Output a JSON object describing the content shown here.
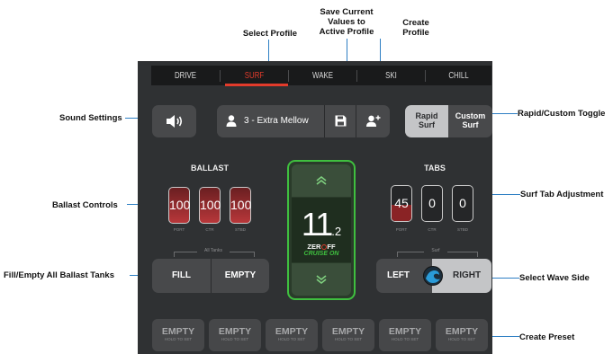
{
  "tabs": [
    "DRIVE",
    "SURF",
    "WAKE",
    "SKI",
    "CHILL"
  ],
  "active_tab": "SURF",
  "profile": {
    "name": "3 - Extra Mellow"
  },
  "surf_toggle": {
    "rapid": "Rapid Surf",
    "rapid_line1": "Rapid",
    "rapid_line2": "Surf",
    "custom_line1": "Custom",
    "custom_line2": "Surf",
    "selected": "Rapid Surf"
  },
  "ballast": {
    "title": "BALLAST",
    "tanks": [
      {
        "label": "PORT",
        "value": "100"
      },
      {
        "label": "CTR",
        "value": "100"
      },
      {
        "label": "STBD",
        "value": "100"
      }
    ],
    "all_tanks_label": "All Tanks",
    "fill_label": "FILL",
    "empty_label": "EMPTY"
  },
  "speed": {
    "whole": "11",
    "decimal": ".2",
    "brand": "ZERO OFF",
    "brand_left": "ZER",
    "brand_right": "FF",
    "status": "CRUISE ON"
  },
  "tabs_panel": {
    "title": "TABS",
    "tabs": [
      {
        "label": "PORT",
        "value": "45",
        "fill": 0.45
      },
      {
        "label": "CTR",
        "value": "0",
        "fill": 0
      },
      {
        "label": "STBD",
        "value": "0",
        "fill": 0
      }
    ],
    "surf_label": "Surf",
    "left_label": "LEFT",
    "right_label": "RIGHT",
    "selected_side": "RIGHT"
  },
  "presets": [
    {
      "label": "EMPTY",
      "sub": "HOLD TO SET"
    },
    {
      "label": "EMPTY",
      "sub": "HOLD TO SET"
    },
    {
      "label": "EMPTY",
      "sub": "HOLD TO SET"
    },
    {
      "label": "EMPTY",
      "sub": "HOLD TO SET"
    },
    {
      "label": "EMPTY",
      "sub": "HOLD TO SET"
    },
    {
      "label": "EMPTY",
      "sub": "HOLD TO SET"
    }
  ],
  "callouts": {
    "select_profile": "Select Profile",
    "save_line1": "Save Current",
    "save_line2": "Values to",
    "save_line3": "Active Profile",
    "create_line1": "Create",
    "create_line2": "Profile",
    "sound_settings": "Sound Settings",
    "rapid_custom_toggle": "Rapid/Custom Toggle",
    "ballast_controls": "Ballast Controls",
    "surf_tab_adjustment": "Surf Tab Adjustment",
    "fill_empty_all": "Fill/Empty All Ballast Tanks",
    "select_wave_side": "Select Wave Side",
    "create_preset": "Create Preset"
  },
  "colors": {
    "accent_red": "#e23b2b",
    "ballast_red": "#b8373a",
    "speed_green": "#3fbf3f",
    "callout_line": "#2e7fc4"
  }
}
